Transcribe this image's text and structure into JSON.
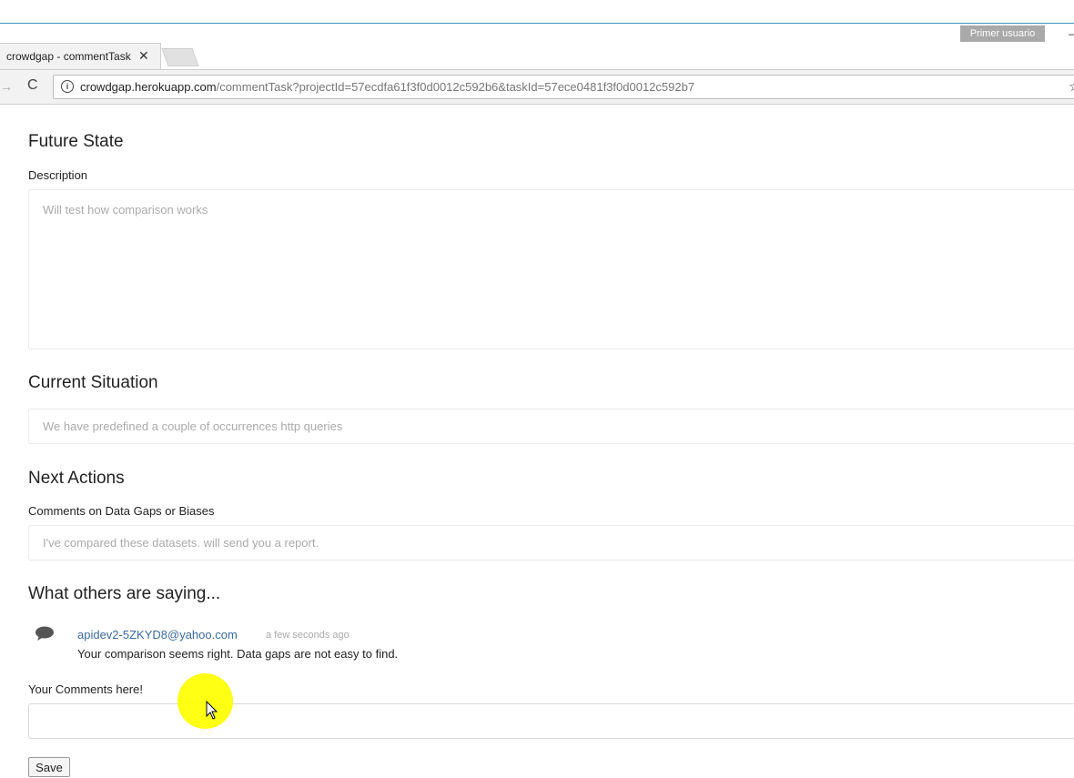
{
  "browser": {
    "profile_label": "Primer usuario",
    "minimize_glyph": "–",
    "tab_title": "crowdgap - commentTask",
    "tab_close": "✕",
    "url_host": "crowdgap.herokuapp.com",
    "url_path": "/commentTask?projectId=57ecdfa61f3f0d0012c592b6&taskId=57ece0481f3f0d0012c592b7",
    "forward_glyph": "→",
    "reload_glyph": "C",
    "info_glyph": "i",
    "star_glyph": "☆",
    "icons": [
      "forward-icon",
      "reload-icon",
      "info-icon",
      "star-icon",
      "close-icon"
    ]
  },
  "future_state": {
    "heading": "Future State",
    "description_label": "Description",
    "description_value": "Will test how comparison works"
  },
  "current_situation": {
    "heading": "Current Situation",
    "value": "We have predefined a couple of occurrences http queries"
  },
  "next_actions": {
    "heading": "Next Actions",
    "comments_label": "Comments on Data Gaps or Biases",
    "comments_value": "I've compared these datasets. will send you a report."
  },
  "others": {
    "heading": "What others are saying...",
    "comments": [
      {
        "author": "apidev2-5ZKYD8@yahoo.com",
        "time": "a few seconds ago",
        "text": "Your comparison seems right. Data gaps are not easy to find."
      }
    ]
  },
  "your_comments": {
    "label": "Your Comments here!",
    "value": "",
    "save_label": "Save"
  },
  "colors": {
    "link": "#3b6aa0",
    "cursor_highlight": "#ffff00",
    "profile_badge": "#a9a9a9"
  }
}
